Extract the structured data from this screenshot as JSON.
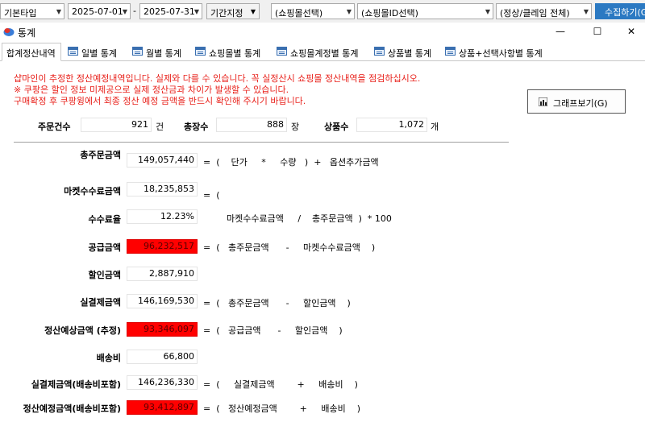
{
  "filters": {
    "type_select": "기본타입",
    "date_from": "2025-07-01",
    "date_separator": "-",
    "date_to": "2025-07-31",
    "period_button": "기간지정",
    "mall_select": "(쇼핑몰선택)",
    "mall_id_select": "(쇼핑몰ID선택)",
    "status_select": "(정상/클레임 전체)",
    "collect_button": "수집하기(G"
  },
  "window": {
    "title": "통계",
    "minimize": "—",
    "maximize": "☐",
    "close": "✕"
  },
  "tabs": [
    {
      "label": "합계정산내역",
      "active": true
    },
    {
      "label": "일별 통계"
    },
    {
      "label": "월별 통계"
    },
    {
      "label": "쇼핑몰별 통계"
    },
    {
      "label": "쇼핑몰계정별 통계"
    },
    {
      "label": "상품별 통계"
    },
    {
      "label": "상품+선택사항별 통계"
    }
  ],
  "notices": [
    "샵마인이 추정한 정산예정내역입니다. 실제와 다를 수 있습니다. 꼭 실정산시 쇼핑몰 정산내역을 점검하십시오.",
    "※ 쿠팡은 할인 정보 미제공으로 실제 정산금과 차이가 발생할 수 있습니다.",
    "구매확정 후 쿠팡윙에서 최종 정산 예정 금액을 반드시 확인해 주시기 바랍니다."
  ],
  "graph_button": "그래프보기(G)",
  "summary": {
    "order_count_label": "주문건수",
    "order_count": "921",
    "order_count_unit": "건",
    "qty_label": "총장수",
    "qty": "888",
    "qty_unit": "장",
    "product_count_label": "상품수",
    "product_count": "1,072",
    "product_count_unit": "개"
  },
  "rows": {
    "total_order": {
      "label": "총주문금액",
      "value": "149,057,440",
      "formula": "=  (    단가     *     수량   )  +   옵션추가금액"
    },
    "market_fee": {
      "label": "마켓수수료금액",
      "value": "18,235,853",
      "formula": "=  ("
    },
    "fee_rate": {
      "label": "수수료율",
      "value": "12.23%",
      "formula": "마켓수수료금액     /    총주문금액  )  * 100"
    },
    "supply": {
      "label": "공급금액",
      "value": "96,232,517",
      "formula": "=  (   총주문금액      -     마켓수수료금액    )"
    },
    "discount": {
      "label": "할인금액",
      "value": "2,887,910",
      "formula": ""
    },
    "real_payment": {
      "label": "실결제금액",
      "value": "146,169,530",
      "formula": "=  (   총주문금액      -     할인금액    )"
    },
    "expected_settle": {
      "label": "정산예상금액 (추정)",
      "value": "93,346,097",
      "formula": "=  (   공급금액      -     할인금액    )"
    },
    "shipping": {
      "label": "배송비",
      "value": "66,800",
      "formula": ""
    },
    "real_payment_ship": {
      "label": "실결제금액(배송비포함)",
      "value": "146,236,330",
      "formula": "=  (     실결제금액        +     배송비    )"
    },
    "expected_settle_ship": {
      "label": "정산예정금액(배송비포함)",
      "value": "93,412,897",
      "formula": "=  (   정산예정금액        +     배송비    )"
    }
  },
  "colors": {
    "highlight_red": "#ff0000",
    "notice_red": "#e8201a",
    "collect_blue": "#2b79c2"
  }
}
